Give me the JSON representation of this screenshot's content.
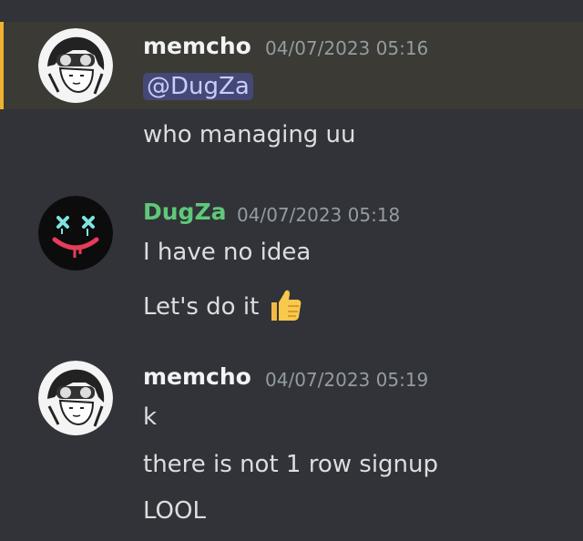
{
  "messages": [
    {
      "author": "memcho",
      "timestamp": "04/07/2023 05:16",
      "mention": "@DugZa",
      "lines": [
        "who managing uu"
      ],
      "avatar": "anime-goggles-avatar"
    },
    {
      "author": "DugZa",
      "timestamp": "04/07/2023 05:18",
      "lines": [
        "I have no idea",
        "Let's do it"
      ],
      "emoji": "thumbs-up-emoji",
      "avatar": "neon-smiley-avatar"
    },
    {
      "author": "memcho",
      "timestamp": "04/07/2023 05:19",
      "lines": [
        "k",
        "there is not 1 row signup",
        "LOOL"
      ],
      "avatar": "anime-goggles-avatar"
    }
  ],
  "colors": {
    "background": "#313338",
    "highlight_bg": "#3b3a34",
    "highlight_bar": "#f0b232",
    "mention_bg": "#454875",
    "mention_text": "#c9cdfb",
    "dugza_name": "#5fc87a"
  }
}
